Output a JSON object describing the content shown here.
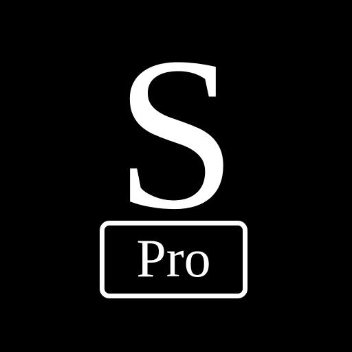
{
  "logo": {
    "letter": "S",
    "badge_text": "Pro"
  },
  "colors": {
    "background": "#000000",
    "foreground": "#ffffff"
  }
}
